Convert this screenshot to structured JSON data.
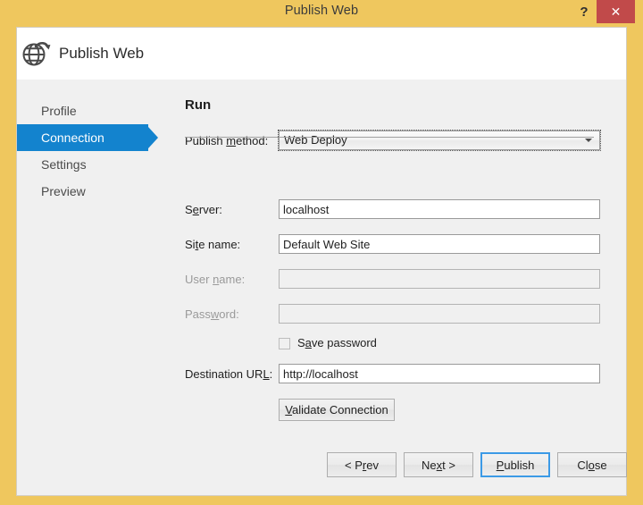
{
  "window": {
    "title": "Publish Web",
    "help_icon": "question-mark-icon",
    "close_icon": "✕",
    "frame_color": "#efc75e",
    "close_button_color": "#c14a4a"
  },
  "header": {
    "title": "Publish Web",
    "icon": "globe-publish-icon"
  },
  "sidebar": {
    "items": [
      {
        "label": "Profile",
        "selected": false
      },
      {
        "label": "Connection",
        "selected": true
      },
      {
        "label": "Settings",
        "selected": false
      },
      {
        "label": "Preview",
        "selected": false
      }
    ],
    "selected_color": "#1383ce"
  },
  "main": {
    "section_title": "Run",
    "publish_method": {
      "label_pre": "Publish ",
      "label_acc": "m",
      "label_post": "ethod:",
      "value": "Web Deploy",
      "options": [
        "Web Deploy"
      ]
    },
    "fields": [
      {
        "label_pre": "S",
        "label_acc": "e",
        "label_post": "rver:",
        "value": "localhost",
        "placeholder": "",
        "disabled": false
      },
      {
        "label_pre": "Si",
        "label_acc": "t",
        "label_post": "e name:",
        "value": "Default Web Site",
        "placeholder": "",
        "disabled": false
      },
      {
        "label_pre": "User ",
        "label_acc": "n",
        "label_post": "ame:",
        "value": "",
        "placeholder": "",
        "disabled": true
      },
      {
        "label_pre": "Pass",
        "label_acc": "w",
        "label_post": "ord:",
        "value": "",
        "placeholder": "",
        "disabled": true
      }
    ],
    "save_password": {
      "label_pre": "S",
      "label_acc": "a",
      "label_post": "ve password",
      "checked": false,
      "disabled": true
    },
    "destination_url": {
      "label_pre": "Destination UR",
      "label_acc": "L",
      "label_post": ":",
      "value": "http://localhost"
    },
    "validate_button": {
      "label_pre": "",
      "label_acc": "V",
      "label_post": "alidate Connection"
    }
  },
  "footer": {
    "buttons": [
      {
        "label_pre": "< P",
        "label_acc": "r",
        "label_post": "ev",
        "focused": false
      },
      {
        "label_pre": "Ne",
        "label_acc": "x",
        "label_post": "t >",
        "focused": false
      },
      {
        "label_pre": "",
        "label_acc": "P",
        "label_post": "ublish",
        "focused": true
      },
      {
        "label_pre": "Cl",
        "label_acc": "o",
        "label_post": "se",
        "focused": false
      }
    ],
    "focus_color": "#3c9ae6"
  }
}
